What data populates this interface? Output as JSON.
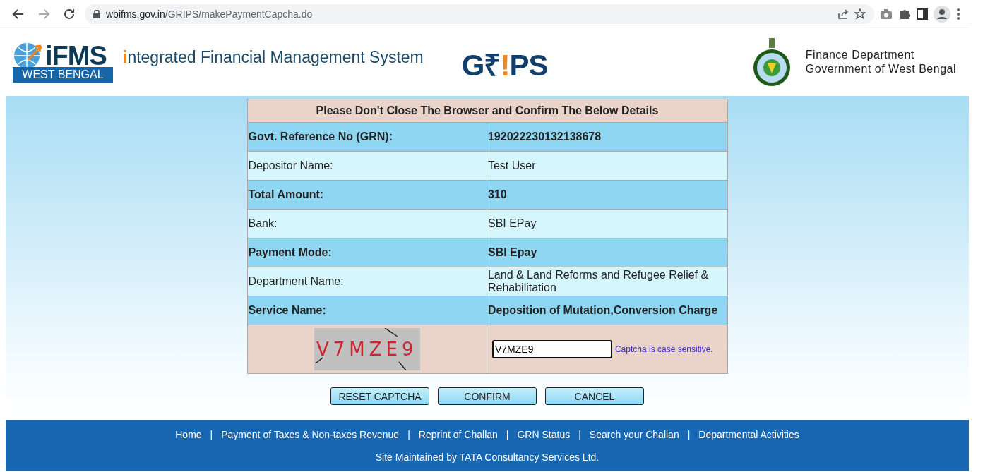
{
  "browser": {
    "url_host": "wbifms.gov.in",
    "url_path": "/GRIPS/makePaymentCapcha.do"
  },
  "header": {
    "ifms_logo": {
      "main": "iFMS",
      "sub": "WEST BENGAL"
    },
    "title_initial": "i",
    "title_rest": "ntegrated Financial Management System",
    "grips_logo": {
      "start": "G₹",
      "accent": "!",
      "end": "PS"
    },
    "department": [
      "Finance Department",
      "Government of West Bengal"
    ]
  },
  "details": {
    "heading": "Please Don't Close The Browser and Confirm The Below Details",
    "rows": [
      {
        "label": "Govt. Reference No (GRN):",
        "value": "192022230132138678",
        "emphasis": true
      },
      {
        "label": "Depositor Name:",
        "value": "Test User",
        "emphasis": false
      },
      {
        "label": "Total Amount:",
        "value": "310",
        "emphasis": true
      },
      {
        "label": "Bank:",
        "value": "SBI EPay",
        "emphasis": false
      },
      {
        "label": "Payment Mode:",
        "value": "SBI Epay",
        "emphasis": true
      },
      {
        "label": "Department Name:",
        "value": "Land & Land Reforms and Refugee Relief & Rehabilitation",
        "emphasis": false
      },
      {
        "label": "Service Name:",
        "value": "Deposition of Mutation,Conversion Charge",
        "emphasis": true
      }
    ],
    "captcha": {
      "image_text": "V7MZE9",
      "value": "V7MZE9",
      "hint": "Captcha is case sensitive."
    }
  },
  "buttons": [
    "RESET CAPTCHA",
    "CONFIRM",
    "CANCEL"
  ],
  "footer": {
    "links": [
      "Home",
      "Payment of Taxes & Non-taxes Revenue",
      "Reprint of Challan",
      "GRN Status",
      "Search your Challan",
      "Departmental Activities"
    ],
    "separator": "|",
    "credit": "Site Maintained by TATA Consultancy Services Ltd."
  }
}
